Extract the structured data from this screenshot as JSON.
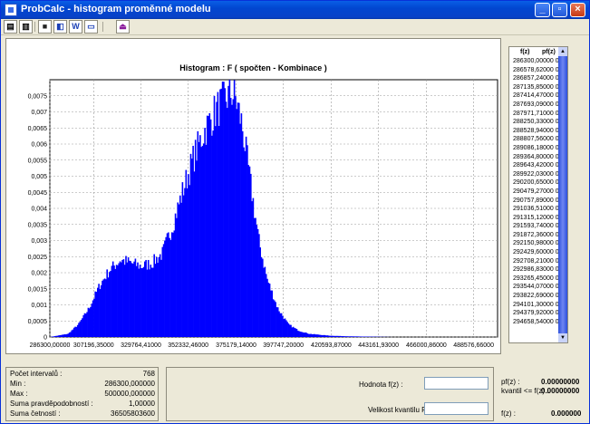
{
  "window": {
    "title": "ProbCalc - histogram proměnné modelu"
  },
  "toolbar": {
    "buttons": [
      "document-icon",
      "new-document-icon",
      "save-icon",
      "save-as-icon",
      "word-icon",
      "copy-icon",
      "exit-icon"
    ]
  },
  "chart_data": {
    "type": "bar",
    "title": "Histogram : F ( spočten - Kombinace )",
    "xlabel": "",
    "ylabel": "",
    "xlim": [
      286300.0,
      500000.0
    ],
    "ylim": [
      0,
      0.008
    ],
    "yticks": [
      "0,0075",
      "0,007",
      "0,0065",
      "0,006",
      "0,0055",
      "0,005",
      "0,0045",
      "0,004",
      "0,0035",
      "0,003",
      "0,0025",
      "0,002",
      "0,0015",
      "0,001",
      "0,0005",
      "0"
    ],
    "xticks": [
      "286300,00000",
      "307196,35000",
      "329764,41000",
      "352332,46000",
      "375179,14000",
      "397747,20000",
      "420593,87000",
      "443161,93000",
      "466000,86000",
      "488576,66000"
    ],
    "x": [
      286300,
      295000,
      300000,
      305000,
      310000,
      315000,
      320000,
      325000,
      330000,
      335000,
      340000,
      345000,
      350000,
      355000,
      360000,
      365000,
      370000,
      373000,
      375000,
      378000,
      382000,
      386000,
      390000,
      395000,
      400000,
      405000,
      410000,
      420000,
      430000,
      440000,
      450000,
      460000,
      480000,
      500000
    ],
    "y": [
      0,
      0.0001,
      0.0004,
      0.0009,
      0.0016,
      0.0021,
      0.0024,
      0.0023,
      0.0022,
      0.0023,
      0.0026,
      0.0035,
      0.0046,
      0.0056,
      0.0064,
      0.007,
      0.0074,
      0.0076,
      0.0074,
      0.0066,
      0.0048,
      0.003,
      0.0018,
      0.0009,
      0.0004,
      0.0002,
      0.0001,
      4e-05,
      2e-05,
      1e-05,
      0,
      0,
      0,
      0
    ],
    "color": "#0000ff",
    "grid": true
  },
  "table": {
    "header_fz": "f(z)",
    "header_pfz": "pf(z)",
    "rows": [
      "286300,00000 0",
      "286578,62000 0",
      "286857,24000 0",
      "287135,85000 0",
      "287414,47000 0",
      "287693,09000 0",
      "287971,71000 0",
      "288250,33000 0",
      "288528,94000 0",
      "288807,56000 0",
      "289086,18000 0",
      "289364,80000 0",
      "289643,42000 0",
      "289922,03000 0",
      "290200,65000 0",
      "290479,27000 0",
      "290757,89000 0",
      "291036,51000 0",
      "291315,12000 0",
      "291593,74000 0",
      "291872,36000 0",
      "292150,98000 0",
      "292429,60000 0",
      "292708,21000 0",
      "292986,83000 0",
      "293265,45000 0",
      "293544,07000 0",
      "293822,69000 0",
      "294101,30000 0",
      "294379,92000 0",
      "294658,54000 0"
    ]
  },
  "stats": [
    {
      "label": "Počet intervalů :",
      "value": "768"
    },
    {
      "label": "Min :",
      "value": "286300,000000"
    },
    {
      "label": "Max :",
      "value": "500000,000000"
    },
    {
      "label": "Suma pravděpodobností :",
      "value": "1,00000"
    },
    {
      "label": "Suma četností :",
      "value": "36505803600"
    }
  ],
  "inputs": {
    "hodnota_label": "Hodnota f(z) :",
    "hodnota_value": "",
    "kvantil_label": "Velikost kvantilu P :",
    "kvantil_value": ""
  },
  "results": {
    "pfz_label": "pf(z) :",
    "pfz_value": "0.00000000",
    "kvantil_label": "kvantil <= f(z) :",
    "kvantil_value": "0.00000000",
    "fz_label": "f(z) :",
    "fz_value": "0.000000"
  }
}
